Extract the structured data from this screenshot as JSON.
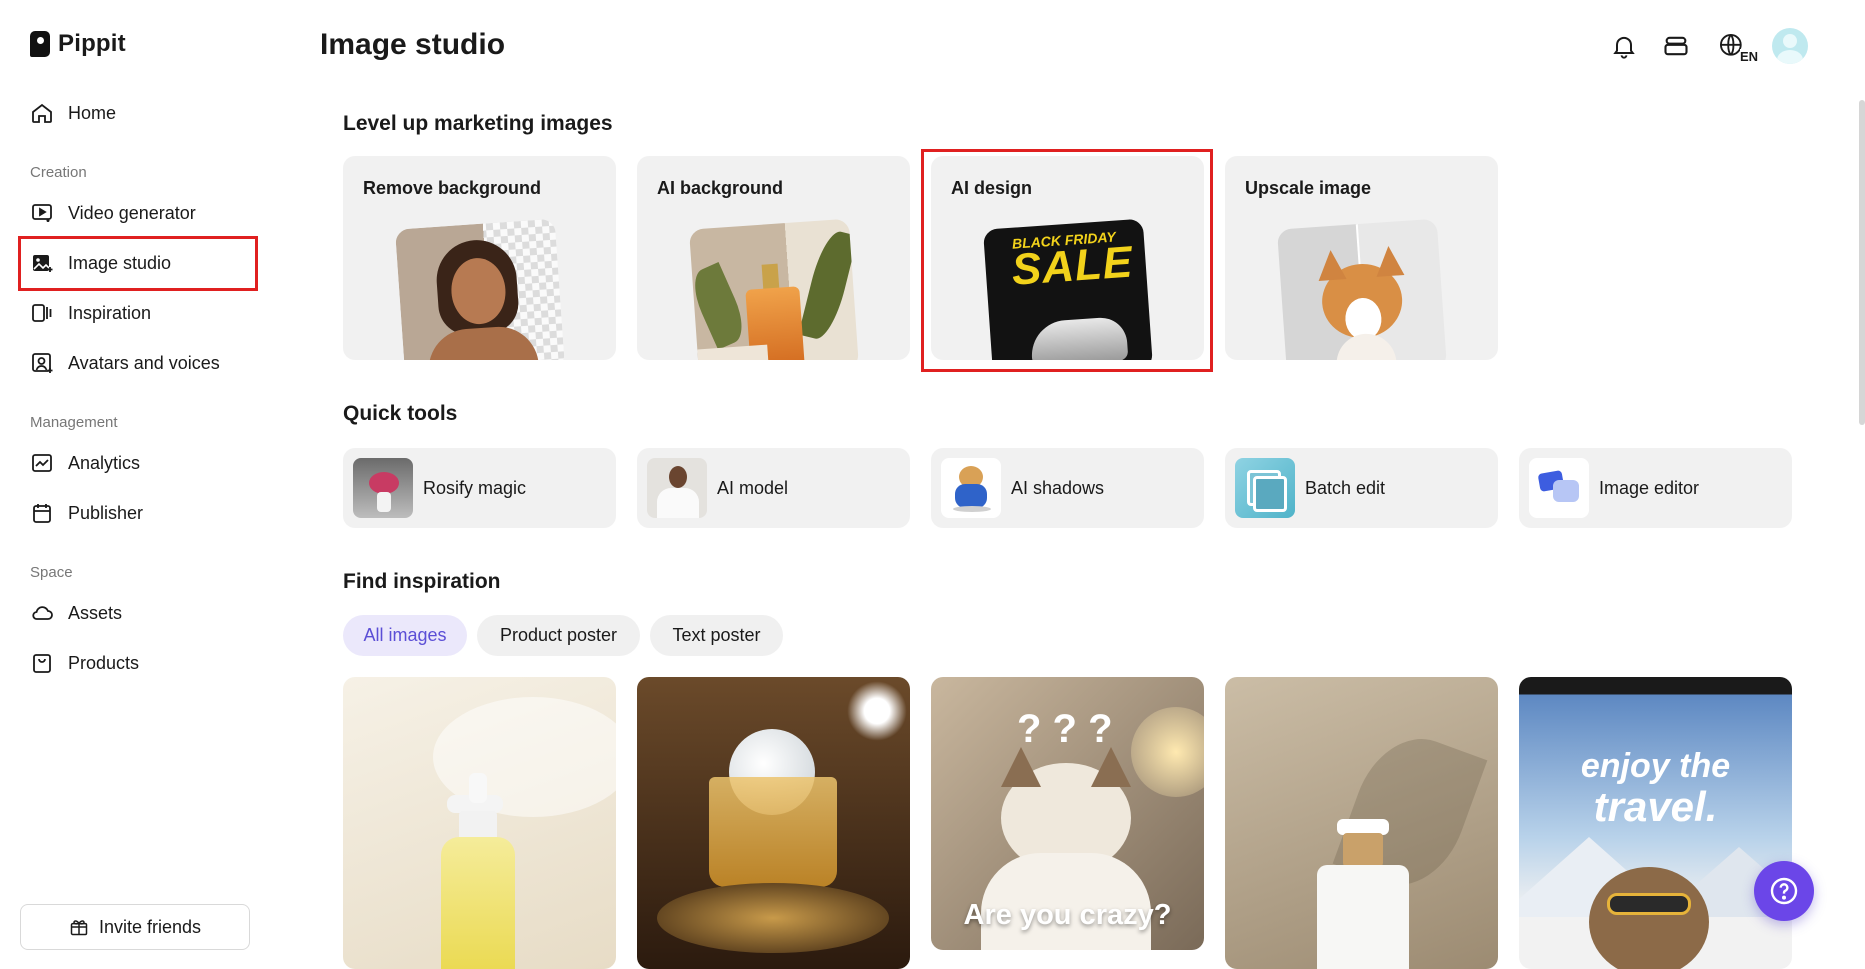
{
  "app": {
    "logo_text": "Pippit",
    "page_title": "Image studio"
  },
  "sidebar": {
    "home": "Home",
    "sections": {
      "creation": "Creation",
      "management": "Management",
      "space": "Space"
    },
    "items": {
      "video_generator": "Video generator",
      "image_studio": "Image studio",
      "inspiration": "Inspiration",
      "avatars_voices": "Avatars and voices",
      "analytics": "Analytics",
      "publisher": "Publisher",
      "assets": "Assets",
      "products": "Products"
    },
    "active_item": "Image studio",
    "invite_label": "Invite friends"
  },
  "header": {
    "language_code": "EN"
  },
  "marketing": {
    "title": "Level up marketing images",
    "cards": [
      {
        "label": "Remove background"
      },
      {
        "label": "AI background"
      },
      {
        "label": "AI design",
        "art_text_top": "BLACK FRIDAY",
        "art_text_main": "SALE"
      },
      {
        "label": "Upscale image"
      }
    ]
  },
  "quick_tools": {
    "title": "Quick tools",
    "items": [
      {
        "label": "Rosify magic"
      },
      {
        "label": "AI model"
      },
      {
        "label": "AI shadows"
      },
      {
        "label": "Batch edit"
      },
      {
        "label": "Image editor"
      }
    ]
  },
  "inspiration": {
    "title": "Find inspiration",
    "filters": [
      "All images",
      "Product poster",
      "Text poster"
    ],
    "active_filter": "All images",
    "cards": [
      {
        "text": ""
      },
      {
        "text": ""
      },
      {
        "text": "Are you crazy?",
        "marks": "? ? ?"
      },
      {
        "text": ""
      },
      {
        "text_line1": "enjoy the",
        "text_line2": "travel."
      }
    ]
  },
  "colors": {
    "accent": "#6b46e8",
    "highlight": "#e02020",
    "chip_active_bg": "#ebe8fb",
    "chip_active_text": "#5b4ed6"
  }
}
